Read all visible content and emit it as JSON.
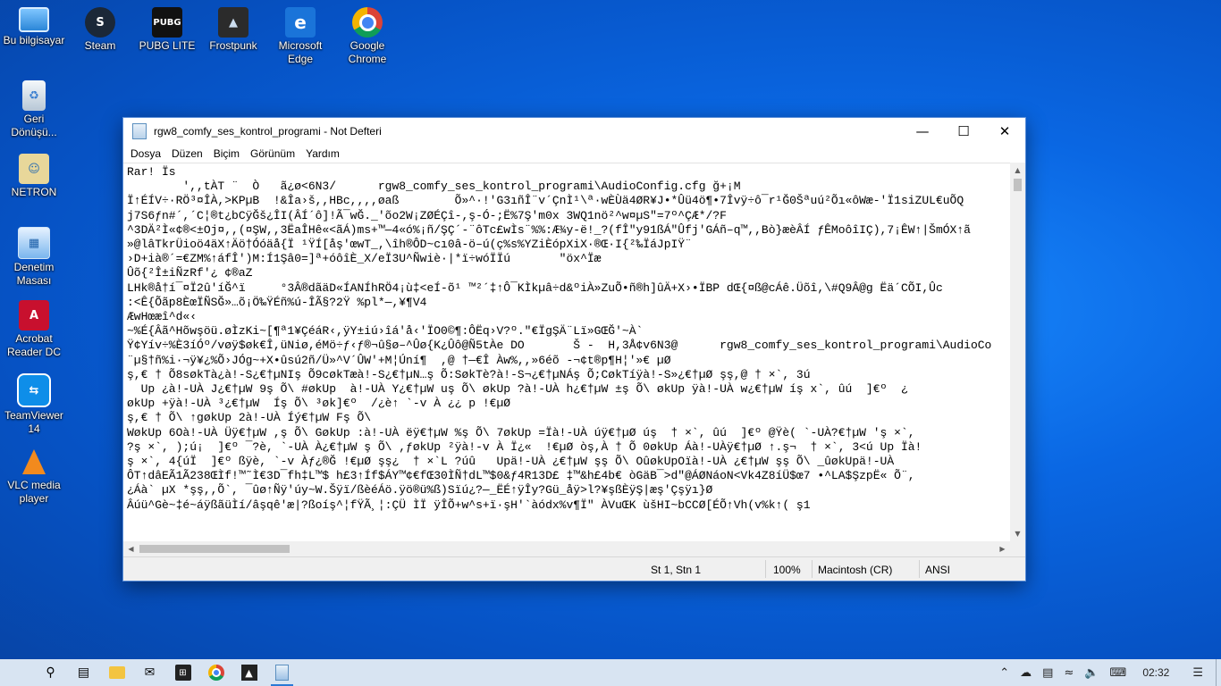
{
  "desktop_icons": [
    {
      "label": "Bu bilgisayar",
      "icon": "computer-icon"
    },
    {
      "label": "Steam",
      "icon": "steam-icon"
    },
    {
      "label": "PUBG LITE",
      "icon": "pubg-icon"
    },
    {
      "label": "Frostpunk",
      "icon": "frostpunk-icon"
    },
    {
      "label": "Microsoft Edge",
      "icon": "edge-icon"
    },
    {
      "label": "Google Chrome",
      "icon": "chrome-icon"
    },
    {
      "label": "Geri Dönüşü...",
      "icon": "recycle-bin-icon"
    },
    {
      "label": "NETRON",
      "icon": "netron-icon"
    },
    {
      "label": "Denetim Masası",
      "icon": "control-panel-icon"
    },
    {
      "label": "Acrobat Reader DC",
      "icon": "acrobat-icon"
    },
    {
      "label": "TeamViewer 14",
      "icon": "teamviewer-icon"
    },
    {
      "label": "VLC media player",
      "icon": "vlc-icon"
    }
  ],
  "window": {
    "title": "rgw8_comfy_ses_kontrol_programi - Not Defteri",
    "menu": [
      "Dosya",
      "Düzen",
      "Biçim",
      "Görünüm",
      "Yardım"
    ],
    "content": "Rar!\u0019\u0007 Ïs\n        ',,tÀT ¨\u0001  Ò\u0001   ã¿ø\u0002<6N3/      rgw8_comfy_ses_kontrol_programi\\AudioConfig.cfg ğ+¡M\nÏ\u0010↑ÉÍV÷·R\u001b\u001a\u0003Ö³¤ÎÀ,>KPµB  !&Î\u0019a›š,,HB\u0001c,,,,ø\u0017aß        Õ»^·!'G3ıñÎ¨\u0003v´ÇnÌ¹\\ª·wÈÙä4ØR¥J•*Ûü4ö¶•7Îv\u0010ÿ÷ô¯r¹\u0001Ğ0Šªuú²Õı«ôWæ-'Ï1siZUL€uÕQ\nj7S6ƒn#´,´C¦®t¿bC\u0001ÿĞ\u0007š¿ÎI(ÂÍ´ô]!\u0019Ã¯wĞ._'õ\u0002o2W¡ZØÉÇî-,ş-Ó-;Ë%7Ş\u0001'm0x 3WQ1nö\u0001²^w\u0001¤µS\u0001\"=7º^\u0001ÇÆ\u0001*/?F\n^3DÄ²Ì«¢®<±Oj¤,,(¤ŞW,,3ËaÎHê«<ãÁ\u0001)ms+™—4«ó%¡ñ/ŞÇ\u0001´-¨ôTc£wÌs\u0001¨%%:Æ¾y-ë!\u0001_?(fÎ\"y91ß\u0001Á\"Ûfj\u0001'GÁñ–q™,,Bò}æèÂÍ \u0001ƒÊM\u0001oôîIÇ),7¡Ê\u0001W↑|ŠmÓX↑ã\n»@l\u0001âTkr\u0001Üioö4äX↑\u0001Äö†\u0001Óóäå{Ï ¹ŸÍ[åş'œwT_,\\î\u0001h®\u0001ÔD~cı0â-ö–ú(ç%s%\u0001YZ\u0001iÈópX\u0001iX·®Œ\u0001·I{²‰ÏáJp\u0001IŸ¨\n›D+ià®´=€ZM%\u0001↑áfÎ')M:Í1Şâ0=]ª+óôî\u0001È\u0001_X/\u0001eÏ3U^Ñwiè\u0001·\u0001|*ï÷wóÏÏú       \"öx^\u0001Ïæ\n\u0001Ûõ{²Î±\u0001iÑzR\u0001f'¿ ¢®aZ\nLH\u0001k\u0001®\u0001å†í¯¤\u0001Ï\u00012û\u0001'íĞ^ï     °3Â®dãäD«ÍANÍhRÖ4¡ù‡<eÍ-õ\u0001¹ ™²´‡↑Ô¯KÌ\u0001kµâ÷d&ºiÀ»\u0001ZuÕ•ñ®h]û\u0001Ä+X›•ÏBP dŒ{¤ß@c\u0001Áê.Üõî,\\#\u0001Q9Â@g Ë\u0001ä´CÕI\u0001,Ûc\n:<Ê{Õãp8ÈœÏÑSĞ»…õ¡Ö‰ŸÉñ%ú-ÎÃ§?2Ÿ %pl*—,¥¶V4\u0001\nÆwHœæî\u0001^\u0001d«‹\n~%É{Âã^Hõ\u0001wşöü.øÌzKi~[¶\u0001ª1¥ÇéáR‹\u0001,ÿY±iú›î\u0001á'å‹'ÏO0©¶:ÔËq›V?º.\"€ÏgŞÄ¨Lï»GŒĞ'~À`\nŸ¢Yív÷%È\u00013íÓº/vøÿ$øk€Î,üNiø,éMö÷ƒ‹ƒ®¬û§ø–\u0001^Ûø{\u0001K¿Ûô@Ñ5tÀe DO       Š -  H,3Å¢v6N3@      rgw8_comfy_ses_kontrol_programi\\AudioCo\n¨µ§†ñ%i·¬ÿ¥¿%Õ›JÓg~+X\u0001•ûsú2ñ/\u0001Ü»^V´ÛW'+M¦Úní¶ \u0001 ,@ †—€Î À\u0001w\u0001%,,»6éõ -¬¢t\u0001®p¶H¦'»€ µØ\nş,€ † Õ8sø\u0001kTà¿à!-S¿€†µNIş \u0001Õ9cø\u0001kTæ\u0001à!-S¿€†µN…ş \u0001Õ:Sø\u0001kTè?à!-S¬¿€†µNÁş \u0001Õ;Cø\u0001kTíÿà!-S»¿€†µØ şş,@ † ×`, \u00013ú\n  \u0001\u0001Up \u0001¿à!-UÀ J¿€†µW \u00019ş \u0001Õ\\ \u0001#ø\u0001kUp \u0001 à!-UÀ Y¿€†µW \u0001uş \u0001Õ\\ \u0001\u0001ø\u0001kUp \u0001?à!-UÀ h¿€†µW \u0001±ş \u0001Õ\\ \u0001ø\u0001kUp ÿà!-UÀ w¿€†µW \u0001íş \u0001x`, \u0001ûú\u0001  \u0001\u0001]€º  ¿\n\u0001ø\u0001kUp +ÿà!-UÀ ³¿€†µW  Íş \u0001Õ\\ \u0001³ø\u0001k]€º  /¿è↑ \u0001`-v À ¿¿ p !€µØ\u0001 \u0001\nş,€ † Õ\\ ↑gø\u0001kUp 2à!-UÀ Íý€†µW \u0001Fş \u0001Õ\\\nWø\u0001kUp 6Oà!-UÀ Üÿ€†µW \u0001,ş \u0001Õ\\ \u0001Gø\u0001kUp :\u0001à!-UÀ ëÿ€†µW \u0001%ş \u0001Õ\\ \u00017ø\u0001kUp =Ïà!-UÀ úÿ€†µØ\u0001 \u0001úş  † ×`, \u0001ûú\u0001  \u0001\u0001]€º @Ÿè( \u0001`-UÀ\u0001\u0001?€†µW \u0001'ş \u0001×`,\n?ş \u0001×`, );ú¡  \u0001\u0001]€º ¯?è, \u0001`-UÀ À¿€†µW \u0001\u0001ş \u0001Õ\\ ,ƒø\u0001kUp ²ÿà!-v À Ï¿«  !€µØ\u0001 \u0001òş,À † Õ 0\u0001ø\u0001kUp Á\u0001à!-UÀ\u0001\u0001ÿ€†µØ\u0001 ↑.ş¬  † ×`, 3<ú\u0001 \u0001\u0001Up Ïà!\n\u0001ş \u0001×`, 4{úÏ  \u0001\u0001]€º ßÿè, \u0001`-v À\u0001ƒ¿®Ğ !€µØ\u0001 \u0001şş¿  † ×`L ?úû \u0001  \u0001\u0001Up\u0001\u0001ä!-UÀ\u0001 ¿€†µW \u0001şş \u0001Õ\\ Oûø\u0001kUp\u0001Oïà!-UÀ\u0001 ¿€†µW \u0001şş \u0001Õ\\ _ûø\u0001kUp\u0001\u0001ä!-UÀ\nÔT\u0001↑\u0001dâEÃ1\u0001Ã2\u000138ŒÌf!™˜Ì€3D\u0001¯fh‡L\u0001™$ \u0001h£3↑Í\u0001f$ÁY™¢€fŒ30ÌÑ†dL\u0001™$0&ƒ4R13D\u0001£\u0001 ‡™\u0001&h£4b€ òGäB¯\u0001>d\"@ÁØNáoN<Vk4Z\u00018íÜ$œ7\u0001\u0001 •^LA$ŞzpË« Õ¨,\n\u0001¿Áà` µX\u0001 *şş\u0001\u0001,,Õ`, ¯ûø↑\u0001Ñÿ'úy~W.Šÿï/ßèéÁö.ÿö®ü%ß)Sï\u0001ú¿?—_ËÉ↑ÿÎy?Gü_åÿ>l?¥şßÈÿŞ|\u0001æş'Çşÿı}Ø\nÂúü^Gè~‡é~\u0001áÿßãüÌí/âşqê'æ|?ßoíş^¦\u0001fŸÃ¸¦:\u0001ÇÜ ÌÏ ÿÎ\u0001Õ\u0001\u0001+w^s+ï·şH'\u0001`àódx%v¶\u0001Ï\" ÀV\u0001uŒK ùšHI~bCCØ[ÉÕ↑Vh(v%k↑( ş1"
  },
  "status": {
    "position": "St 1, Stn 1",
    "zoom": "100%",
    "line_ending": "Macintosh (CR)",
    "encoding": "ANSI"
  },
  "taskbar": {
    "items": [
      "start-icon",
      "search-icon",
      "task-view-icon",
      "file-explorer-icon",
      "mail-icon",
      "calculator-icon",
      "chrome-icon",
      "photos-icon",
      "notepad-icon"
    ],
    "time": "02:32"
  }
}
